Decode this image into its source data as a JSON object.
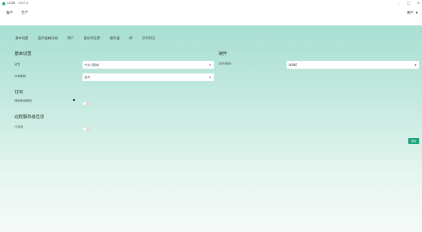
{
  "titlebar": {
    "title": "aSUN - V3.0.4",
    "minimize": "–",
    "maximize": "□",
    "close": "×"
  },
  "menubar": {
    "items": [
      "客户",
      "生产"
    ],
    "user_label": "用户"
  },
  "tabs": [
    "基本设置",
    "医疗器械法规",
    "用户",
    "备份和还原",
    "服务器",
    "库",
    "实时日志"
  ],
  "basic": {
    "title": "基本设置",
    "language_label": "语言",
    "language_value": "中文 (简体)",
    "font_label": "字体缩放",
    "font_value": "放大"
  },
  "hardware": {
    "title": "硬件",
    "device_label": "3D扫描仪",
    "device_value": "NONE"
  },
  "subscribe": {
    "title": "订阅",
    "label": "接收新闻通知"
  },
  "remote": {
    "title": "远程服务器连接",
    "label": "已启用"
  },
  "save_label": "保存",
  "colors": {
    "accent": "#1fa37a",
    "gradient_top": "#a9dfd3"
  }
}
